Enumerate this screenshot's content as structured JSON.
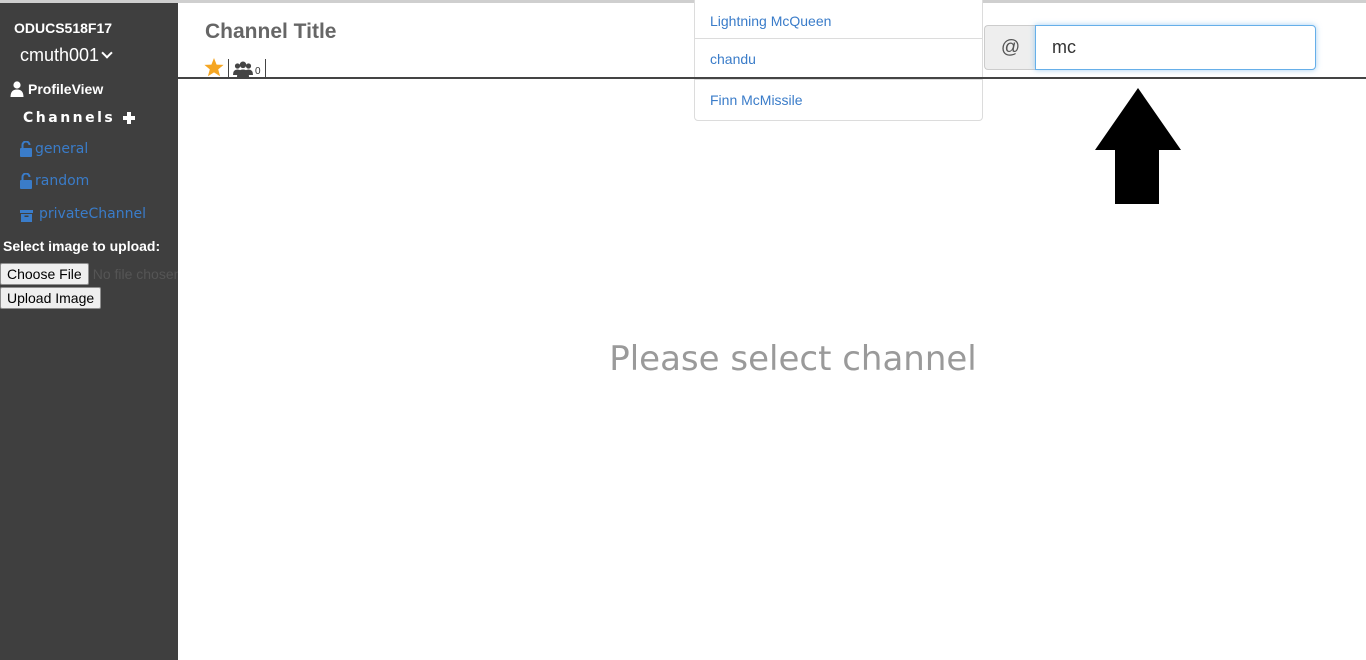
{
  "sidebar": {
    "team_name": "ODUCS518F17",
    "username": "cmuth001",
    "profile_label": "ProfileView",
    "channels_header": "Channels",
    "channels": [
      {
        "name": "general",
        "icon": "unlock-icon"
      },
      {
        "name": "random",
        "icon": "unlock-icon"
      },
      {
        "name": "privateChannel",
        "icon": "archive-icon"
      }
    ],
    "upload_label": "Select image to upload:",
    "choose_file_label": "Choose File",
    "no_file_text": "No file chosen",
    "upload_button_label": "Upload Image"
  },
  "header": {
    "channel_title": "Channel Title",
    "member_count": "0",
    "star_color": "#f5a623"
  },
  "mention": {
    "prefix": "@",
    "query": "mc",
    "suggestions": [
      "Lightning McQueen",
      "chandu",
      "Finn McMissile"
    ]
  },
  "main": {
    "empty_message": "Please select channel"
  },
  "colors": {
    "sidebar_bg": "#3f3f3f",
    "link_blue": "#3a7cc9",
    "input_focus": "#66afe9"
  }
}
